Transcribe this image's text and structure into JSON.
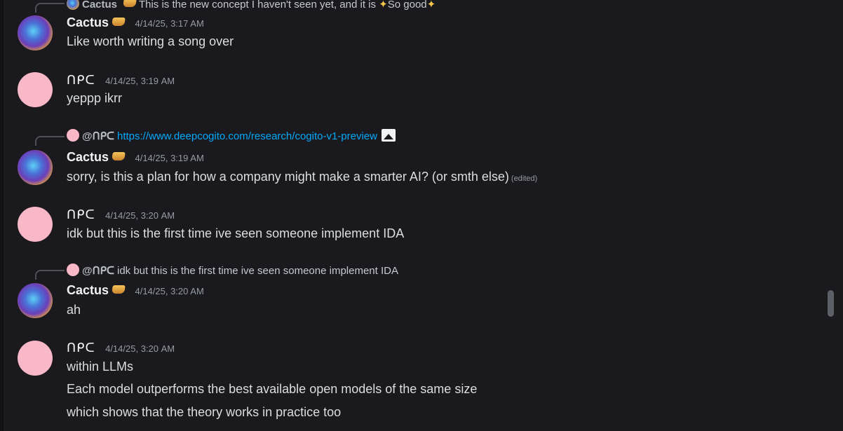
{
  "top_reply": {
    "name": "Cactus",
    "text_before": "This is the new concept I haven't seen yet, and it is",
    "text_after": "So good"
  },
  "messages": [
    {
      "author": "Cactus",
      "timestamp": "4/14/25, 3:17 AM",
      "lines": [
        "Like worth writing a song over"
      ]
    },
    {
      "author": "ᑎᑭᑕ",
      "timestamp": "4/14/25, 3:19 AM",
      "lines": [
        "yeppp ikrr"
      ]
    },
    {
      "reply_mention": "@ᑎᑭᑕ",
      "reply_link": "https://www.deepcogito.com/research/cogito-v1-preview",
      "author": "Cactus",
      "timestamp": "4/14/25, 3:19 AM",
      "lines": [
        "sorry, is this a plan for how a company might make a smarter AI? (or smth else)"
      ],
      "edited": "(edited)"
    },
    {
      "author": "ᑎᑭᑕ",
      "timestamp": "4/14/25, 3:20 AM",
      "lines": [
        "idk but this is the first time ive seen someone implement IDA"
      ]
    },
    {
      "reply_mention": "@ᑎᑭᑕ",
      "reply_text": "idk but this is the first time ive seen someone implement IDA",
      "author": "Cactus",
      "timestamp": "4/14/25, 3:20 AM",
      "lines": [
        "ah"
      ]
    },
    {
      "author": "ᑎᑭᑕ",
      "timestamp": "4/14/25, 3:20 AM",
      "lines": [
        "within LLMs",
        "Each model outperforms the best available open models of the same size",
        "which shows that the theory works in practice too"
      ]
    }
  ]
}
